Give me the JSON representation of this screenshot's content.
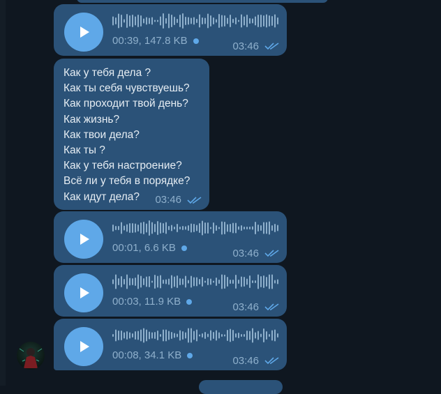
{
  "messages": [
    {
      "type": "voice",
      "duration_size": "00:39, 147.8 KB",
      "time": "03:46"
    },
    {
      "type": "text",
      "lines": [
        "Как у тебя дела ?",
        "Как ты себя чувствуешь?",
        "Как проходит твой день?",
        "Как жизнь?",
        "Как твои дела?",
        "Как ты ?",
        "Как у тебя настроение?",
        "Всё ли у тебя в порядке?",
        "Как идут дела?"
      ],
      "time": "03:46"
    },
    {
      "type": "voice",
      "duration_size": "00:01, 6.6 KB",
      "time": "03:46"
    },
    {
      "type": "voice",
      "duration_size": "00:03, 11.9 KB",
      "time": "03:46"
    },
    {
      "type": "voice",
      "duration_size": "00:08, 34.1 KB",
      "time": "03:46"
    }
  ],
  "colors": {
    "bubble": "#2b5278",
    "accent": "#5fa8e8",
    "meta": "#8fb0cc",
    "background": "#0f1720"
  },
  "icons": {
    "play": "play-icon",
    "read": "double-check-icon",
    "unplayed": "unplayed-dot"
  }
}
